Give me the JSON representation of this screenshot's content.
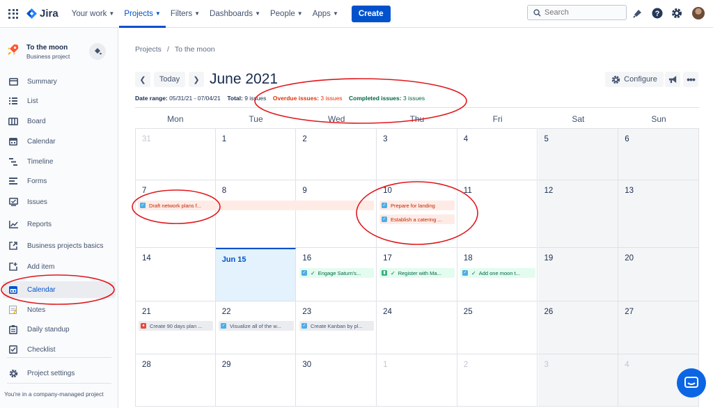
{
  "topbar": {
    "product": "Jira",
    "nav": [
      "Your work",
      "Projects",
      "Filters",
      "Dashboards",
      "People",
      "Apps"
    ],
    "active_nav": "Projects",
    "create_label": "Create",
    "search_placeholder": "Search"
  },
  "sidebar": {
    "project_name": "To the moon",
    "project_type": "Business project",
    "items": [
      {
        "label": "Summary",
        "icon": "summary-icon"
      },
      {
        "label": "List",
        "icon": "list-icon"
      },
      {
        "label": "Board",
        "icon": "board-icon"
      },
      {
        "label": "Calendar",
        "icon": "calendar-icon"
      },
      {
        "label": "Timeline",
        "icon": "timeline-icon"
      },
      {
        "label": "Forms",
        "icon": "forms-icon"
      },
      {
        "label": "Issues",
        "icon": "issues-icon"
      },
      {
        "label": "Reports",
        "icon": "reports-icon"
      },
      {
        "label": "Business projects basics",
        "icon": "external-link-icon"
      },
      {
        "label": "Add item",
        "icon": "add-item-icon"
      },
      {
        "label": "Calendar",
        "icon": "calendar-icon",
        "active": true
      },
      {
        "label": "Notes",
        "icon": "notes-icon"
      },
      {
        "label": "Daily standup",
        "icon": "standup-icon"
      },
      {
        "label": "Checklist",
        "icon": "checklist-icon"
      },
      {
        "label": "Project settings",
        "icon": "gear-icon"
      }
    ],
    "footer": "You're in a company-managed project"
  },
  "main": {
    "breadcrumb": [
      "Projects",
      "To the moon"
    ],
    "today_label": "Today",
    "month_title": "June 2021",
    "configure_label": "Configure",
    "stats": {
      "range_label": "Date range:",
      "range_value": "05/31/21 - 07/04/21",
      "total_label": "Total:",
      "total_value": "9 issues",
      "overdue_label": "Overdue issues:",
      "overdue_value": "3 issues",
      "completed_label": "Completed issues:",
      "completed_value": "3 issues"
    },
    "weekdays": [
      "Mon",
      "Tue",
      "Wed",
      "Thu",
      "Fri",
      "Sat",
      "Sun"
    ],
    "weeks": [
      [
        "31",
        "1",
        "2",
        "3",
        "4",
        "5",
        "6"
      ],
      [
        "7",
        "8",
        "9",
        "10",
        "11",
        "12",
        "13"
      ],
      [
        "14",
        "Jun 15",
        "16",
        "17",
        "18",
        "19",
        "20"
      ],
      [
        "21",
        "22",
        "23",
        "24",
        "25",
        "26",
        "27"
      ],
      [
        "28",
        "29",
        "30",
        "1",
        "2",
        "3",
        "4"
      ]
    ],
    "events": [
      {
        "title": "Draft network plans f...",
        "status": "overdue",
        "type": "task"
      },
      {
        "title": "Prepare for landing",
        "status": "overdue",
        "type": "task"
      },
      {
        "title": "Establish a catering ...",
        "status": "overdue",
        "type": "task"
      },
      {
        "title": "Engage Saturn's...",
        "status": "done",
        "type": "task"
      },
      {
        "title": "Register with Ma...",
        "status": "done",
        "type": "story"
      },
      {
        "title": "Add one moon t...",
        "status": "done",
        "type": "task"
      },
      {
        "title": "Create 90 days plan ...",
        "status": "todo",
        "type": "bug"
      },
      {
        "title": "Visualize all of the w...",
        "status": "todo",
        "type": "task"
      },
      {
        "title": "Create Kanban by pl...",
        "status": "todo",
        "type": "task"
      }
    ]
  },
  "colors": {
    "accent": "#0052cc",
    "overdue": "#de350b",
    "done": "#006644",
    "annotation": "#e0161b"
  }
}
